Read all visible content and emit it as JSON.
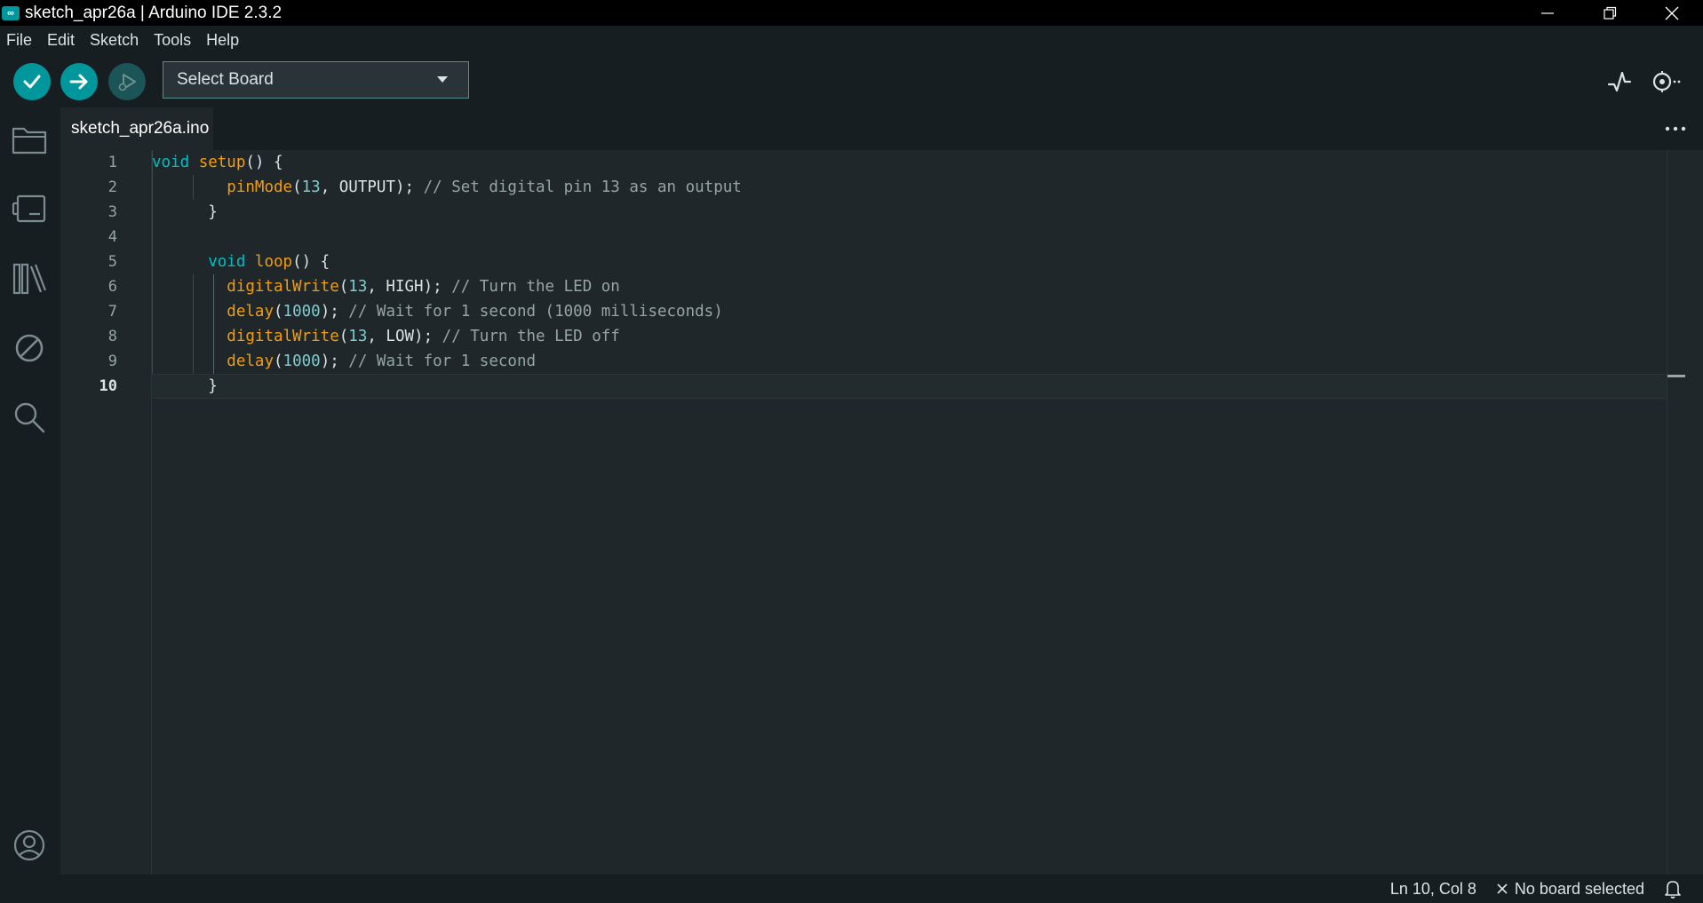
{
  "window": {
    "title": "sketch_apr26a | Arduino IDE 2.3.2",
    "app_icon": "arduino-infinity-icon"
  },
  "menu": {
    "items": [
      "File",
      "Edit",
      "Sketch",
      "Tools",
      "Help"
    ]
  },
  "toolbar": {
    "verify": "checkmark-icon",
    "upload": "arrow-right-icon",
    "debug": "debug-play-icon",
    "board_select_label": "Select Board",
    "serial_plotter": "plotter-icon",
    "serial_monitor": "serial-monitor-icon"
  },
  "sidebar": {
    "icons": [
      "folder-icon",
      "board-manager-icon",
      "library-icon",
      "debug-no-icon",
      "search-icon",
      "account-icon"
    ]
  },
  "tabs": [
    {
      "label": "sketch_apr26a.ino",
      "active": true
    }
  ],
  "editor": {
    "current_line": 10,
    "lines": [
      {
        "n": "1",
        "tokens": [
          [
            "kw",
            "void"
          ],
          [
            "plain",
            " "
          ],
          [
            "fn",
            "setup"
          ],
          [
            "plain",
            "() {"
          ]
        ]
      },
      {
        "n": "2",
        "tokens": [
          [
            "plain",
            "        "
          ],
          [
            "fn",
            "pinMode"
          ],
          [
            "plain",
            "("
          ],
          [
            "num",
            "13"
          ],
          [
            "plain",
            ", OUTPUT); "
          ],
          [
            "cm",
            "// Set digital pin 13 as an output"
          ]
        ]
      },
      {
        "n": "3",
        "tokens": [
          [
            "plain",
            "      }"
          ]
        ]
      },
      {
        "n": "4",
        "tokens": []
      },
      {
        "n": "5",
        "tokens": [
          [
            "plain",
            "      "
          ],
          [
            "kw",
            "void"
          ],
          [
            "plain",
            " "
          ],
          [
            "fn",
            "loop"
          ],
          [
            "plain",
            "() {"
          ]
        ]
      },
      {
        "n": "6",
        "tokens": [
          [
            "plain",
            "        "
          ],
          [
            "fn",
            "digitalWrite"
          ],
          [
            "plain",
            "("
          ],
          [
            "num",
            "13"
          ],
          [
            "plain",
            ", HIGH); "
          ],
          [
            "cm",
            "// Turn the LED on"
          ]
        ]
      },
      {
        "n": "7",
        "tokens": [
          [
            "plain",
            "        "
          ],
          [
            "fn",
            "delay"
          ],
          [
            "plain",
            "("
          ],
          [
            "num",
            "1000"
          ],
          [
            "plain",
            "); "
          ],
          [
            "cm",
            "// Wait for 1 second (1000 milliseconds)"
          ]
        ]
      },
      {
        "n": "8",
        "tokens": [
          [
            "plain",
            "        "
          ],
          [
            "fn",
            "digitalWrite"
          ],
          [
            "plain",
            "("
          ],
          [
            "num",
            "13"
          ],
          [
            "plain",
            ", LOW); "
          ],
          [
            "cm",
            "// Turn the LED off"
          ]
        ]
      },
      {
        "n": "9",
        "tokens": [
          [
            "plain",
            "        "
          ],
          [
            "fn",
            "delay"
          ],
          [
            "plain",
            "("
          ],
          [
            "num",
            "1000"
          ],
          [
            "plain",
            "); "
          ],
          [
            "cm",
            "// Wait for 1 second"
          ]
        ]
      },
      {
        "n": "10",
        "tokens": [
          [
            "plain",
            "      }"
          ]
        ]
      }
    ]
  },
  "status": {
    "cursor_position": "Ln 10, Col 8",
    "board_status": "No board selected",
    "notifications": "bell-icon"
  },
  "colors": {
    "accent": "#00979c",
    "background": "#1f272a",
    "panel": "#171e21"
  }
}
